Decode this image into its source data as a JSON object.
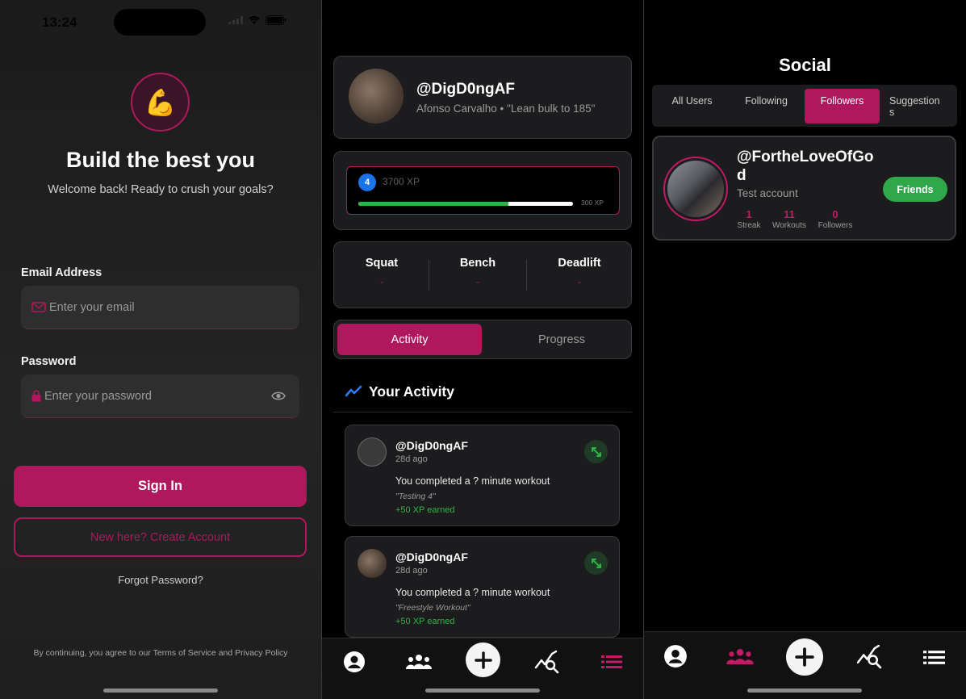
{
  "login": {
    "status_time": "13:24",
    "logo_emoji": "💪",
    "headline": "Build the best you",
    "subline": "Welcome back! Ready to crush your goals?",
    "email_label": "Email Address",
    "email_placeholder": "Enter your email",
    "password_label": "Password",
    "password_placeholder": "Enter your password",
    "sign_in": "Sign In",
    "create_account": "New here? Create Account",
    "forgot": "Forgot Password?",
    "legal": "By continuing, you agree to our Terms of Service and Privacy Policy"
  },
  "profile": {
    "username": "@DigD0ngAF",
    "display": "Afonso Carvalho • \"Lean bulk to 185\"",
    "level": "4",
    "xp": "3700 XP",
    "xp_to_next": "300 XP",
    "xp_progress": 0.7,
    "lifts": [
      {
        "name": "Squat",
        "value": "-"
      },
      {
        "name": "Bench",
        "value": "-"
      },
      {
        "name": "Deadlift",
        "value": "-"
      }
    ],
    "tabs": {
      "activity": "Activity",
      "progress": "Progress"
    },
    "activity_title": "Your Activity",
    "activities": [
      {
        "user": "@DigD0ngAF",
        "ago": "28d ago",
        "msg": "You completed a ? minute workout",
        "note": "\"Testing 4\"",
        "xp": "+50 XP earned"
      },
      {
        "user": "@DigD0ngAF",
        "ago": "28d ago",
        "msg": "You completed a ? minute workout",
        "note": "\"Freestyle Workout\"",
        "xp": "+50 XP earned"
      }
    ]
  },
  "social": {
    "title": "Social",
    "tabs": [
      "All Users",
      "Following",
      "Followers",
      "Suggestion s"
    ],
    "active_tab": "Followers",
    "user": {
      "handle": "@FortheLoveOfGo d",
      "handle_line1": "@FortheLoveOfGo",
      "handle_line2": "d",
      "name": "Test account",
      "stats": [
        {
          "value": "1",
          "label": "Streak"
        },
        {
          "value": "11",
          "label": "Workouts"
        },
        {
          "value": "0",
          "label": "Followers"
        }
      ],
      "button": "Friends"
    }
  },
  "colors": {
    "accent": "#b0185d",
    "success": "#2fb344",
    "level": "#1a73e8"
  }
}
